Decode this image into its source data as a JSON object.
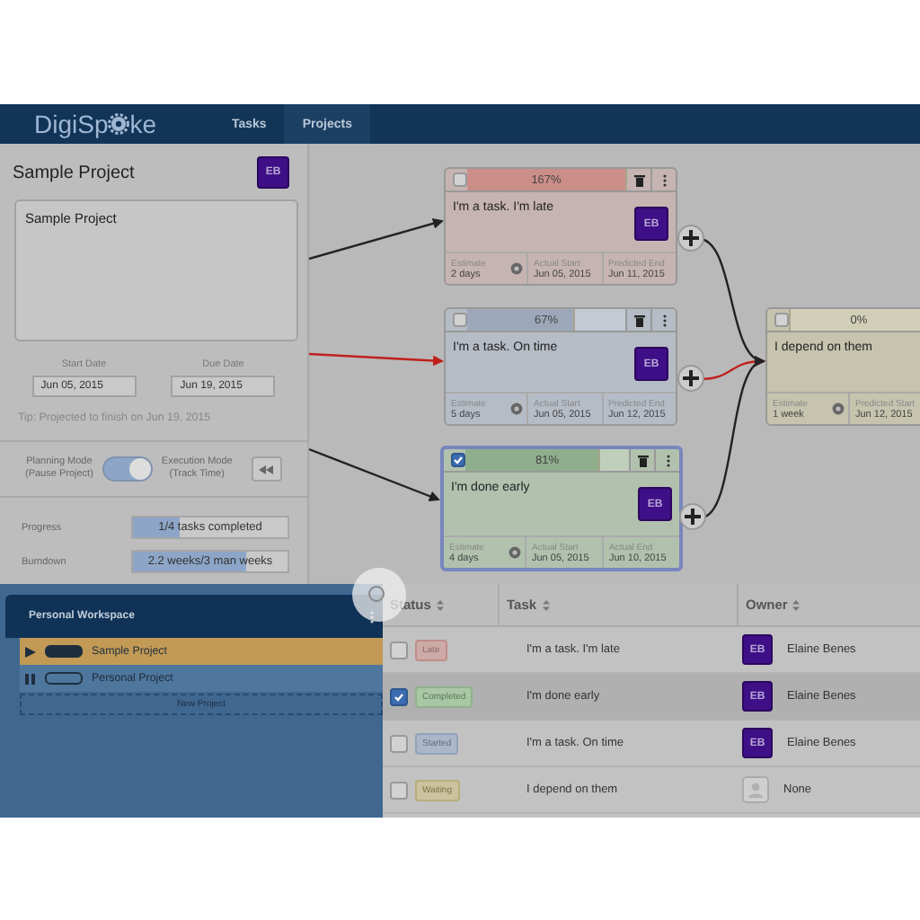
{
  "nav": {
    "logo_start": "DigiSp",
    "logo_end": "ke",
    "tabs": [
      {
        "label": "Tasks",
        "selected": false
      },
      {
        "label": "Projects",
        "selected": true
      }
    ]
  },
  "project": {
    "title": "Sample Project",
    "avatar": "EB",
    "description": "Sample Project",
    "start_label": "Start Date",
    "start_value": "Jun 05, 2015",
    "due_label": "Due Date",
    "due_value": "Jun 19, 2015",
    "tip": "Tip: Projected to finish on Jun 19, 2015",
    "planning_label": [
      "Planning Mode",
      "(Pause Project)"
    ],
    "execution_label": [
      "Execution Mode",
      "(Track Time)"
    ],
    "mode_toggle": {
      "on": true
    },
    "meters": [
      {
        "label": "Progress",
        "level": 0.3,
        "reading": "1/4 tasks completed"
      },
      {
        "label": "Burndown",
        "level": 0.73,
        "reading": "2.2 weeks/3 man weeks"
      }
    ]
  },
  "cards": [
    {
      "kind": "late",
      "checked": false,
      "percent": "167%",
      "level": 1,
      "title": "I'm a task. I'm late",
      "avatar": "EB",
      "actions": true,
      "fields": [
        {
          "label": "Estimate",
          "value": "2 days"
        },
        {
          "label": "Actual Start",
          "value": "Jun 05, 2015"
        },
        {
          "label": "Predicted End",
          "value": "Jun 11, 2015"
        }
      ]
    },
    {
      "kind": "started",
      "checked": false,
      "percent": "67%",
      "level": 0.67,
      "title": "I'm a task. On time",
      "avatar": "EB",
      "actions": true,
      "fields": [
        {
          "label": "Estimate",
          "value": "5 days"
        },
        {
          "label": "Actual Start",
          "value": "Jun 05, 2015"
        },
        {
          "label": "Predicted End",
          "value": "Jun 12, 2015"
        }
      ]
    },
    {
      "kind": "completed",
      "checked": true,
      "percent": "81%",
      "level": 0.81,
      "title": "I'm done early",
      "avatar": "EB",
      "actions": true,
      "fields": [
        {
          "label": "Estimate",
          "value": "4 days"
        },
        {
          "label": "Actual Start",
          "value": "Jun 05, 2015"
        },
        {
          "label": "Actual End",
          "value": "Jun 10, 2015"
        }
      ]
    },
    {
      "kind": "waiting",
      "checked": false,
      "percent": "0%",
      "level": 0,
      "title": "I depend on them",
      "actions": false,
      "fields": [
        {
          "label": "Estimate",
          "value": "1 week"
        },
        {
          "label": "Predicted Start",
          "value": "Jun 12, 2015"
        }
      ]
    }
  ],
  "links": [
    {
      "critical": false
    },
    {
      "critical": true
    },
    {
      "critical": false
    },
    {
      "critical": false
    },
    {
      "critical": true
    },
    {
      "critical": false
    }
  ],
  "workspace": {
    "title": "Personal Workspace",
    "projects": [
      {
        "name": "Sample Project",
        "selected": true,
        "running": true
      },
      {
        "name": "Personal Project",
        "selected": false,
        "running": false
      }
    ],
    "new_button": "New Project"
  },
  "table": {
    "columns": [
      "Status",
      "Task",
      "Owner"
    ],
    "rows": [
      {
        "checked": false,
        "kind": "late",
        "status_label": "Late",
        "task": "I'm a task. I'm late",
        "owner_avatar": "EB",
        "owner": "Elaine Benes",
        "selected": false
      },
      {
        "checked": true,
        "kind": "completed",
        "status_label": "Completed",
        "task": "I'm done early",
        "owner_avatar": "EB",
        "owner": "Elaine Benes",
        "selected": true
      },
      {
        "checked": false,
        "kind": "started",
        "status_label": "Started",
        "task": "I'm a task. On time",
        "owner_avatar": "EB",
        "owner": "Elaine Benes",
        "selected": false
      },
      {
        "checked": false,
        "kind": "waiting",
        "status_label": "Waiting",
        "task": "I depend on them",
        "owner": "None",
        "selected": false
      }
    ]
  }
}
